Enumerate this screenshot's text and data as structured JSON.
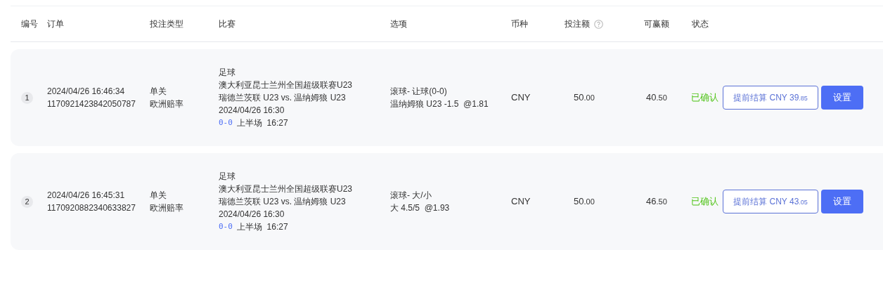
{
  "columns": [
    {
      "label": "编号"
    },
    {
      "label": "订单"
    },
    {
      "label": "投注类型"
    },
    {
      "label": "比赛"
    },
    {
      "label": "选项"
    },
    {
      "label": "币种"
    },
    {
      "label": "投注额",
      "help": true
    },
    {
      "label": "可赢额"
    },
    {
      "label": "状态"
    }
  ],
  "rows": [
    {
      "index": "1",
      "time": "2024/04/26 16:46:34",
      "order_id": "1170921423842050787",
      "bet_type": "单关",
      "odds_type": "欧洲赔率",
      "sport": "足球",
      "league": "澳大利亚昆士兰州全国超级联赛U23",
      "teams": "瑞德兰茨联 U23 vs. 温纳姆狼 U23",
      "kickoff": "2024/04/26 16:30",
      "score": "0-0",
      "period": "上半场  16:27",
      "market": "滚球- 让球(0-0)",
      "pick": "温纳姆狼 U23 -1.5  @1.81",
      "currency": "CNY",
      "stake": {
        "whole": "50",
        "fraction": ".00"
      },
      "win": {
        "whole": "40",
        "fraction": ".50"
      },
      "status": "已确认",
      "cashout": {
        "label": "提前结算",
        "currency": "CNY",
        "whole": "39",
        "fraction": ".85"
      },
      "settings": "设置"
    },
    {
      "index": "2",
      "time": "2024/04/26 16:45:31",
      "order_id": "1170920882340633827",
      "bet_type": "单关",
      "odds_type": "欧洲赔率",
      "sport": "足球",
      "league": "澳大利亚昆士兰州全国超级联赛U23",
      "teams": "瑞德兰茨联 U23 vs. 温纳姆狼 U23",
      "kickoff": "2024/04/26 16:30",
      "score": "0-0",
      "period": "上半场  16:27",
      "market": "滚球- 大/小",
      "pick": "大 4.5/5  @1.93",
      "currency": "CNY",
      "stake": {
        "whole": "50",
        "fraction": ".00"
      },
      "win": {
        "whole": "46",
        "fraction": ".50"
      },
      "status": "已确认",
      "cashout": {
        "label": "提前结算",
        "currency": "CNY",
        "whole": "43",
        "fraction": ".05"
      },
      "settings": "设置"
    }
  ]
}
